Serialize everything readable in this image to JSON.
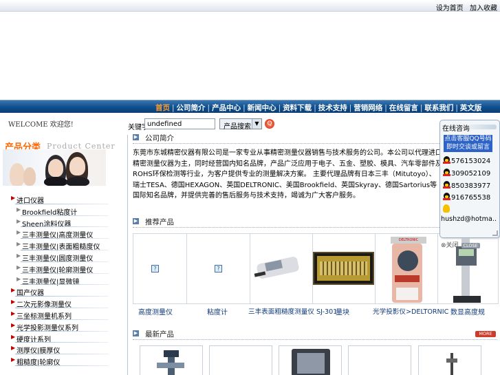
{
  "top_links": [
    "设为首页",
    "加入收藏"
  ],
  "nav": {
    "items": [
      "首页",
      "公司简介",
      "产品中心",
      "新闻中心",
      "资料下载",
      "技术支持",
      "营销网络",
      "在线留言",
      "联系我们",
      "英文版"
    ]
  },
  "welcome_text": "WELCOME 欢迎您!",
  "search": {
    "label": "关键字：",
    "value": "undefined",
    "select_value": "产品搜索",
    "go_icon": "search-go-icon"
  },
  "sidebar": {
    "title_cn": "产品分类",
    "title_en": "Product Center",
    "categories": [
      {
        "label": "进口仪器",
        "level": 1
      },
      {
        "label": "Brookfield粘度计",
        "level": 2
      },
      {
        "label": "Sheen涂料仪器",
        "level": 2
      },
      {
        "label": "三丰测量仪|高度测量仪",
        "level": 2
      },
      {
        "label": "三丰测量仪|表面粗糙度仪",
        "level": 2
      },
      {
        "label": "三丰测量仪|圆度测量仪",
        "level": 2
      },
      {
        "label": "三丰测量仪|轮廓测量仪",
        "level": 2
      },
      {
        "label": "三丰测量仪|显微镜",
        "level": 2
      },
      {
        "label": "国产仪器",
        "level": 1
      },
      {
        "label": "二次元影像测量仪",
        "level": 1
      },
      {
        "label": "三坐标测量机系列",
        "level": 1
      },
      {
        "label": "光学投影测量仪系列",
        "level": 1
      },
      {
        "label": "硬度计系列",
        "level": 1
      },
      {
        "label": "测厚仪|膜厚仪",
        "level": 1
      },
      {
        "label": "粗糙度|轮廓仪",
        "level": 1
      }
    ]
  },
  "about": {
    "title": "公司简介",
    "text": "东莞市东城精密仪器有限公司是一家专业从事精密测量仪器销售与技术服务的公司。本公司以代理进口精密测量仪器为主，同时经营国内知名品牌，产品广泛应用于电子、五金、塑胶、模具、汽车零部件及ROHS环保检测等行业，为客户提供专业的测量解决方案。 主要代理品牌有日本三丰（Mitutoyo）、瑞士TESA、德国HEXAGON、英国DELTRONIC、美国Brookfield、英国Skyray、德国Sartorius等国际知名品牌，并提供完善的售后服务与技术支持，竭诚为广大客户服务。"
  },
  "products": {
    "title": "推荐产品",
    "items": [
      {
        "name": "高度测量仪"
      },
      {
        "name": "粘度计"
      },
      {
        "name": "三丰表面粗糙度测量仪 SJ-301"
      },
      {
        "name": "量块"
      },
      {
        "name": "光学投影仪>DELTORNIC"
      },
      {
        "name": "数显高度规"
      }
    ]
  },
  "new_products": {
    "title": "最新产品",
    "more_label": "MORE"
  },
  "consult": {
    "title": "在线咨询",
    "banner": "点击客服QQ号码即时交谈或留言",
    "qq_numbers": [
      "576153024",
      "309052109",
      "850383977",
      "916765538"
    ],
    "email": "hushzd@hotma..",
    "close_text": "关闭",
    "close_button": "CLOSE"
  }
}
